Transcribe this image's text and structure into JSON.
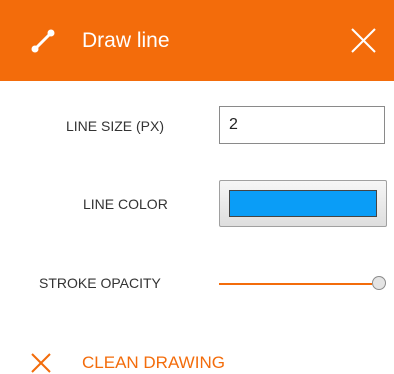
{
  "colors": {
    "accent": "#f36c0b",
    "line_color": "#0a9df7"
  },
  "header": {
    "icon": "line-draw-icon",
    "title": "Draw line",
    "close_icon": "close-icon"
  },
  "line_size": {
    "label": "LINE SIZE (PX)",
    "value": "2"
  },
  "line_color": {
    "label": "LINE COLOR"
  },
  "stroke_opacity": {
    "label": "STROKE OPACITY",
    "value": 1
  },
  "clean": {
    "icon": "close-icon",
    "label": "CLEAN DRAWING"
  }
}
